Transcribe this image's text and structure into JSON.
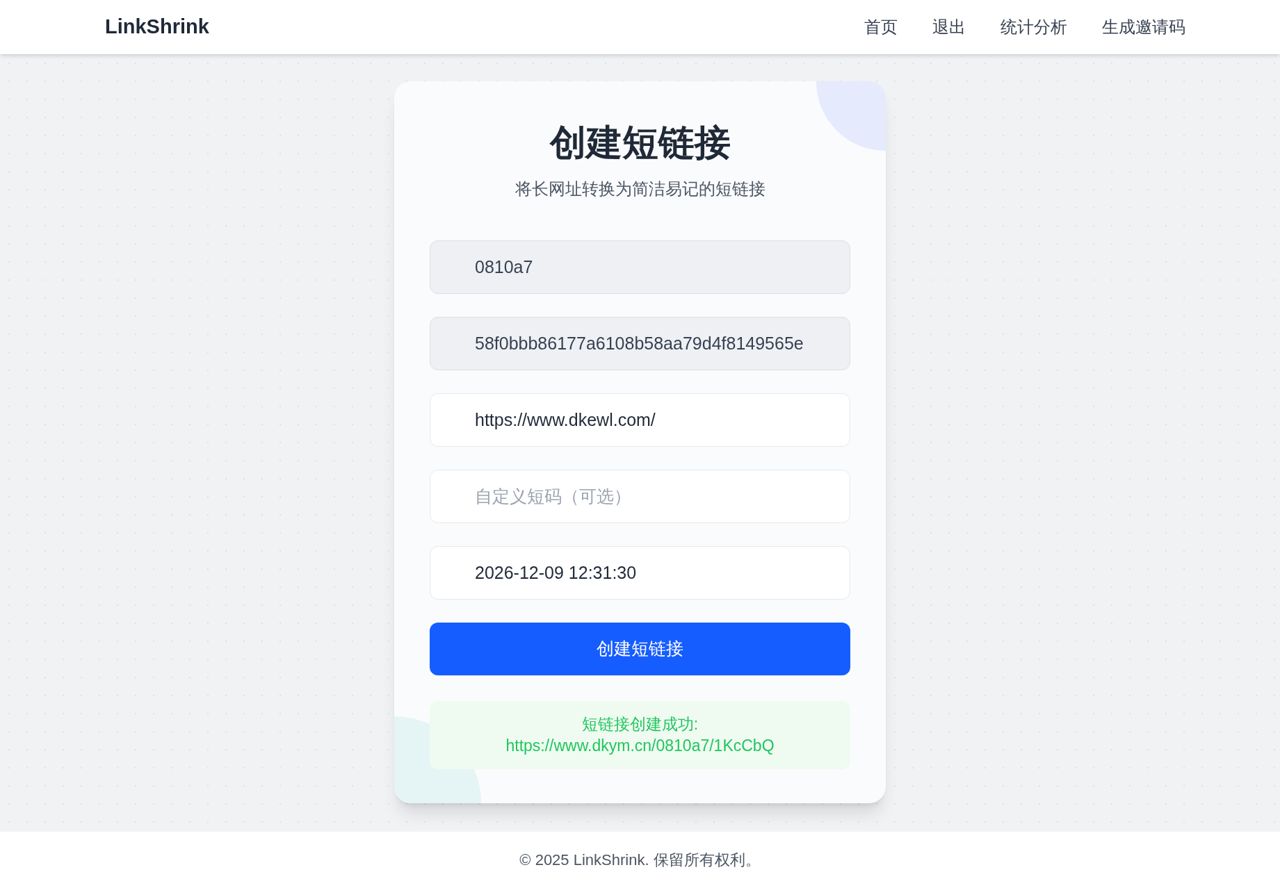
{
  "header": {
    "logo": "LinkShrink",
    "nav": [
      "首页",
      "退出",
      "统计分析",
      "生成邀请码"
    ]
  },
  "card": {
    "title": "创建短链接",
    "subtitle": "将长网址转换为简洁易记的短链接",
    "fields": [
      {
        "value": "0810a7",
        "readonly": true
      },
      {
        "value": "58f0bbb86177a6108b58aa79d4f8149565e",
        "readonly": true
      },
      {
        "value": "https://www.dkewl.com/",
        "readonly": false
      },
      {
        "placeholder": "自定义短码（可选）",
        "readonly": false
      },
      {
        "value": "2026-12-09 12:31:30",
        "readonly": false
      }
    ],
    "button": "创建短链接",
    "result": {
      "message": "短链接创建成功:",
      "link": "https://www.dkym.cn/0810a7/1KcCbQ"
    }
  },
  "footer": "© 2025 LinkShrink. 保留所有权利。"
}
